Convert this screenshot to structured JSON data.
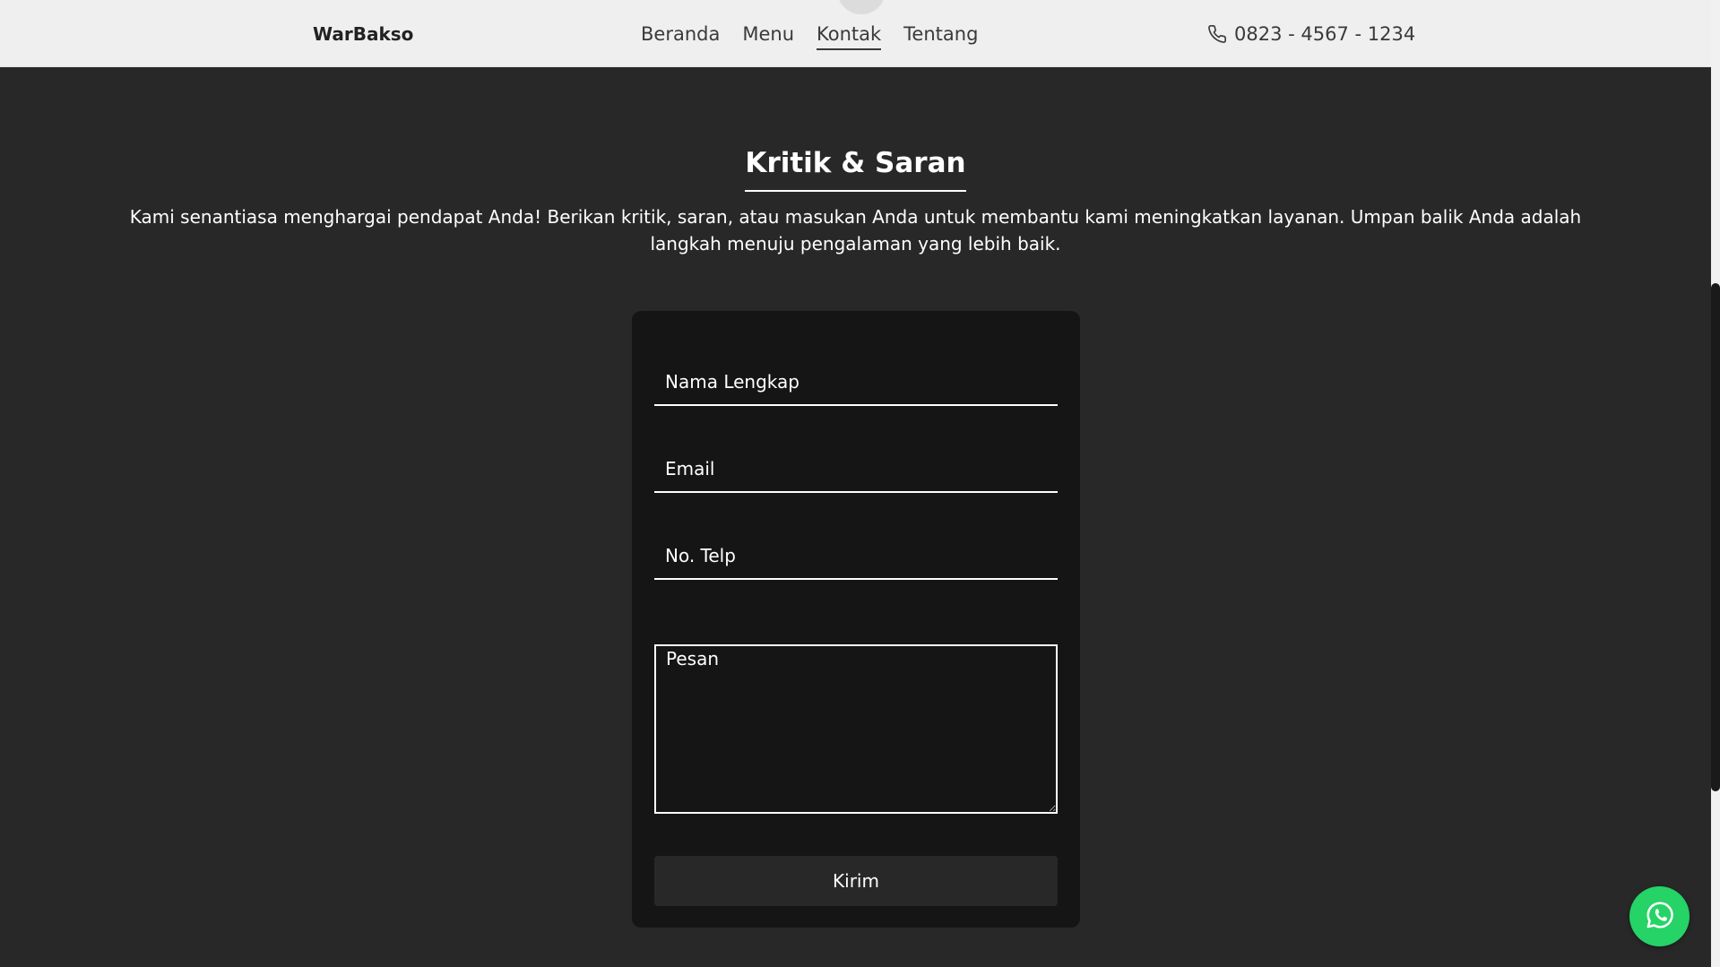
{
  "navbar": {
    "brand": "WarBakso",
    "links": [
      {
        "label": "Beranda",
        "active": false
      },
      {
        "label": "Menu",
        "active": false
      },
      {
        "label": "Kontak",
        "active": true
      },
      {
        "label": "Tentang",
        "active": false
      }
    ],
    "phone": "0823 - 4567 - 1234",
    "phone_icon": "phone-icon"
  },
  "section": {
    "title": "Kritik & Saran",
    "description": "Kami senantiasa menghargai pendapat Anda! Berikan kritik, saran, atau masukan Anda untuk membantu kami meningkatkan layanan. Umpan balik Anda adalah langkah menuju pengalaman yang lebih baik."
  },
  "form": {
    "name_placeholder": "Nama Lengkap",
    "email_placeholder": "Email",
    "phone_placeholder": "No. Telp",
    "message_placeholder": "Pesan",
    "submit_label": "Kirim"
  },
  "fab": {
    "icon": "whatsapp-icon",
    "color": "#25d366"
  },
  "colors": {
    "navbar_bg": "#efefef",
    "page_bg": "#282828",
    "card_bg": "#151515"
  }
}
